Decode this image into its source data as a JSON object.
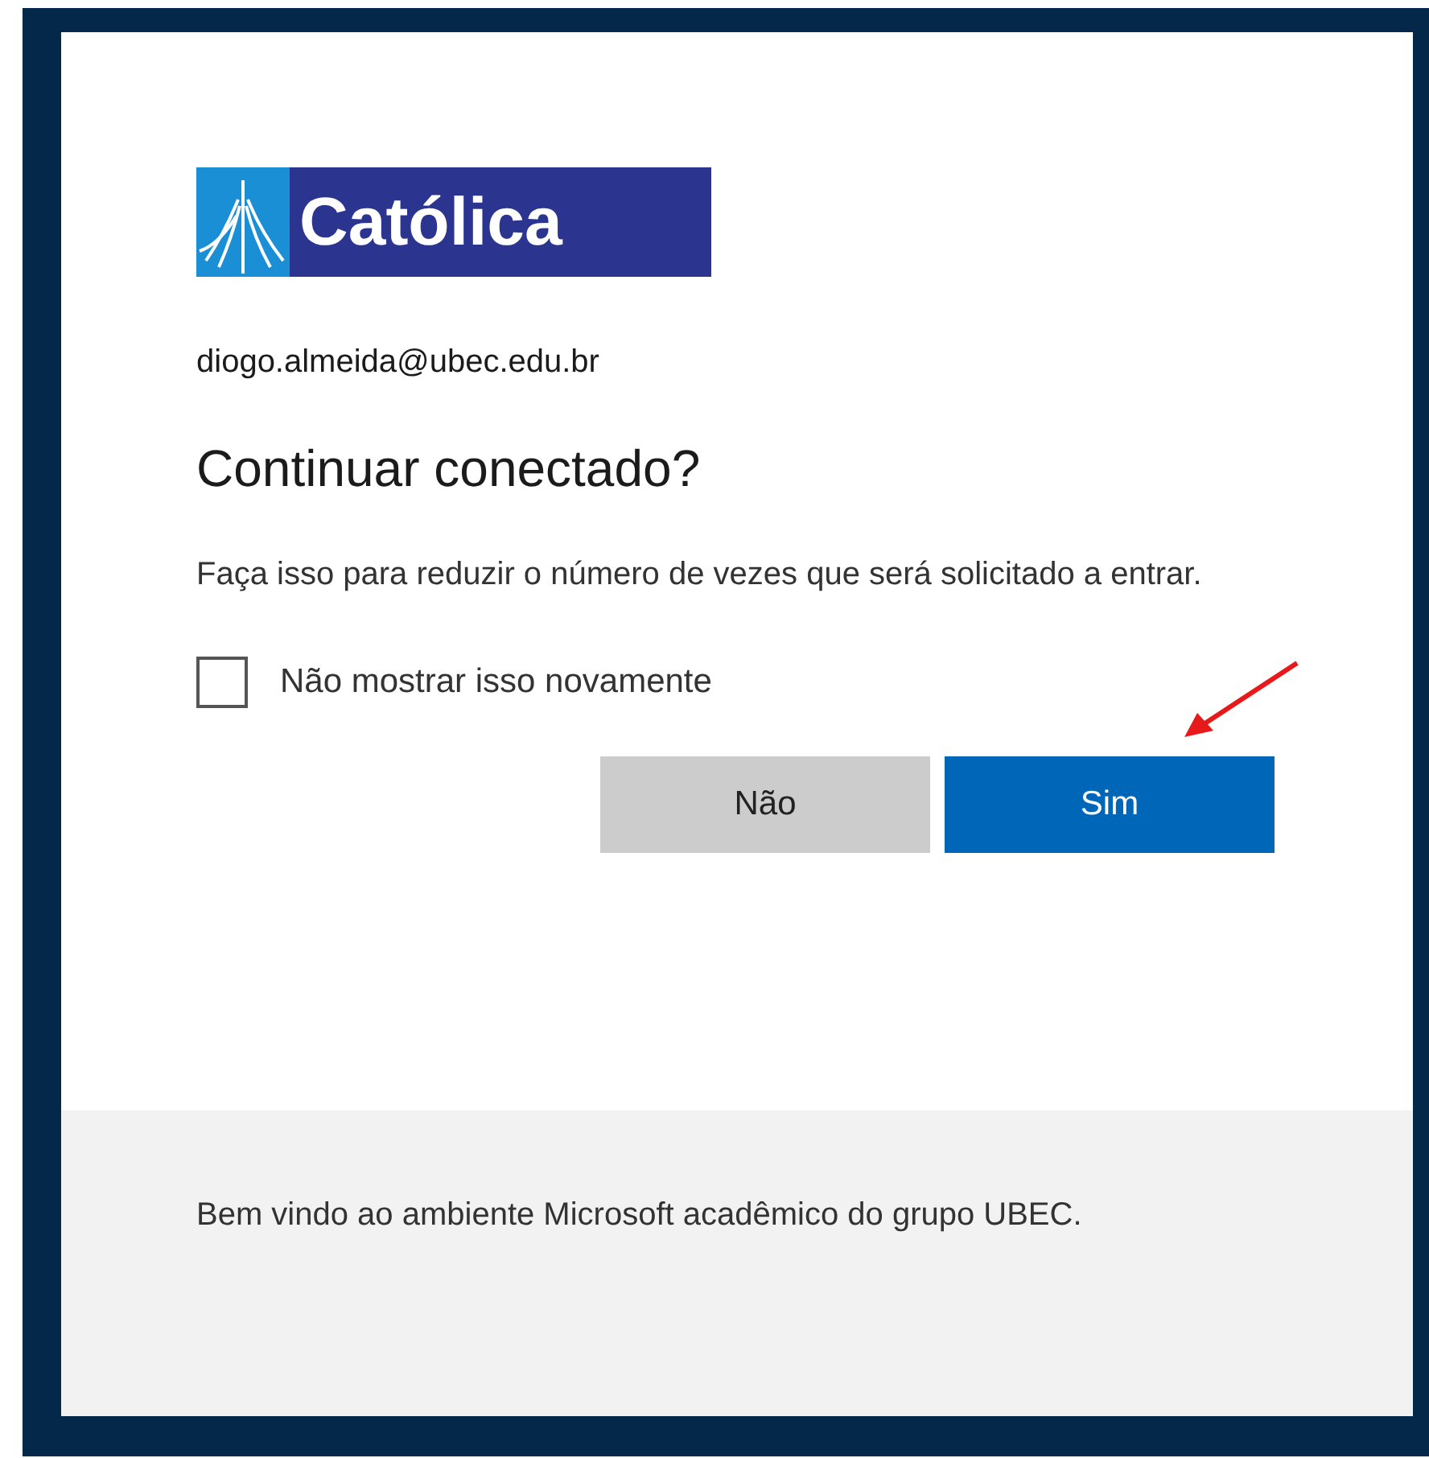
{
  "logo": {
    "text": "Católica"
  },
  "account": "diogo.almeida@ubec.edu.br",
  "title": "Continuar conectado?",
  "description": "Faça isso para reduzir o número de vezes que será solicitado a entrar.",
  "checkbox": {
    "label": "Não mostrar isso novamente",
    "checked": false
  },
  "buttons": [
    {
      "label": "Não",
      "kind": "secondary"
    },
    {
      "label": "Sim",
      "kind": "primary"
    }
  ],
  "footer": "Bem vindo ao ambiente Microsoft acadêmico do grupo UBEC."
}
